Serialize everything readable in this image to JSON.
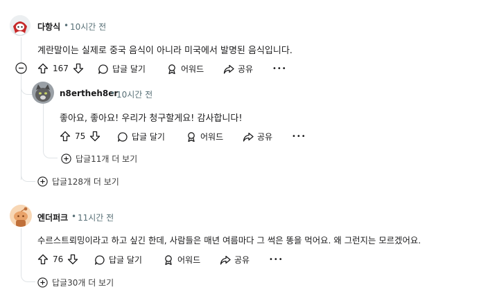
{
  "comments": [
    {
      "author": "다항식",
      "sep": "•",
      "time": "10시간 전",
      "body": "계란말이는 실제로 중국 음식이 아니라 미국에서 발명된 음식입니다.",
      "votes": "167",
      "reply_label": "답글 달기",
      "award_label": "어워드",
      "share_label": "공유",
      "more_label": "•••",
      "more_replies": "답글128개 더 보기",
      "avatar_icon": "snoo-avatar-red-hair",
      "reply": {
        "author": "n8ertheh8er",
        "sep": "•",
        "time": "10시간 전",
        "body": "좋아요, 좋아요! 우리가 청구할게요! 감사합니다!",
        "votes": "75",
        "reply_label": "답글 달기",
        "award_label": "어워드",
        "share_label": "공유",
        "more_label": "•••",
        "more_replies": "답글11개 더 보기",
        "avatar_icon": "cat-photo-avatar"
      }
    },
    {
      "author": "엔더퍼크",
      "sep": "•",
      "time": "11시간 전",
      "body": "수르스트뢰밍이라고 하고 싶긴 한데, 사람들은 매년 여름마다 그 썩은 똥을 먹어요. 왜 그런지는 모르겠어요.",
      "votes": "76",
      "reply_label": "답글 달기",
      "award_label": "어워드",
      "share_label": "공유",
      "more_label": "•••",
      "more_replies": "답글30개 더 보기",
      "avatar_icon": "snoo-avatar-orange"
    }
  ]
}
